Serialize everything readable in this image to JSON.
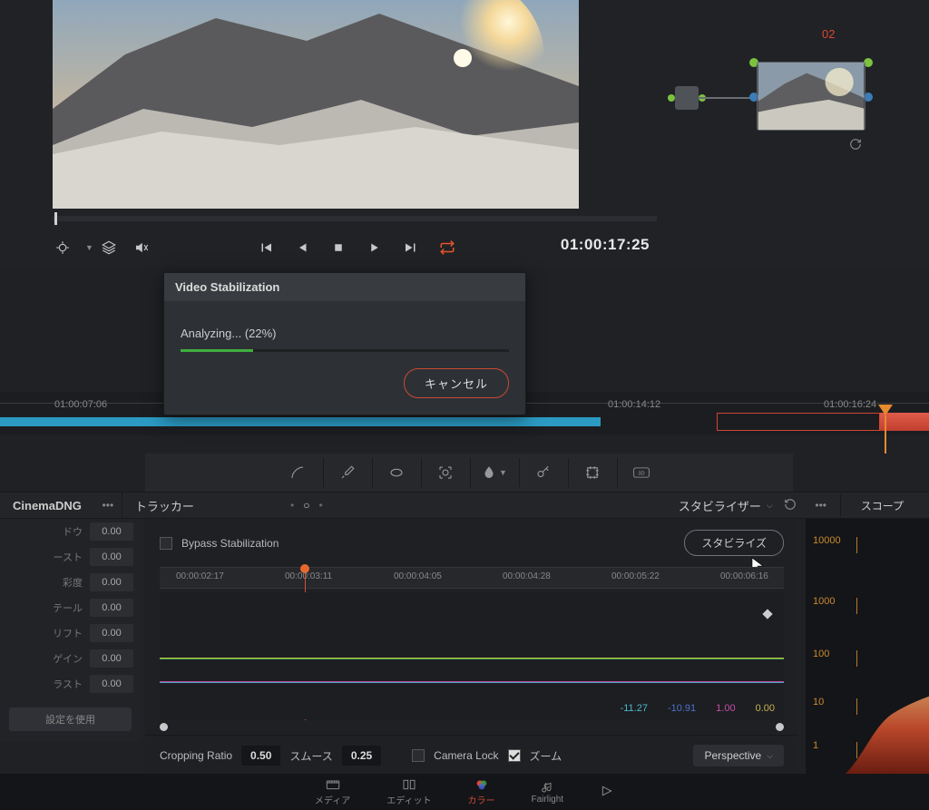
{
  "viewer": {
    "timecode": "01:00:17:25"
  },
  "node": {
    "label": "02"
  },
  "dialog": {
    "title": "Video Stabilization",
    "status": "Analyzing... (22%)",
    "progress_pct": 22,
    "cancel": "キャンセル"
  },
  "ruler": {
    "ticks": [
      {
        "label": "01:00:07:06",
        "pos": 60
      },
      {
        "label": "01:00:14:12",
        "pos": 670
      },
      {
        "label": "01:00:16:24",
        "pos": 908
      }
    ]
  },
  "panels": {
    "left_tab": "CinemaDNG",
    "tracker": "トラッカー",
    "stabilizer": "スタビライザー",
    "scope": "スコープ"
  },
  "params": [
    {
      "label": "ドウ",
      "value": "0.00"
    },
    {
      "label": "ースト",
      "value": "0.00"
    },
    {
      "label": "彩度",
      "value": "0.00"
    },
    {
      "label": "テール",
      "value": "0.00"
    },
    {
      "label": "リフト",
      "value": "0.00"
    },
    {
      "label": "ゲイン",
      "value": "0.00"
    },
    {
      "label": "ラスト",
      "value": "0.00"
    }
  ],
  "params_button": "設定を使用",
  "tracker_panel": {
    "bypass": "Bypass Stabilization",
    "stabilize": "スタビライズ",
    "ticks": [
      {
        "label": "00:00:02:17",
        "pos": 18
      },
      {
        "label": "00:00:03:11",
        "pos": 138
      },
      {
        "label": "00:00:04:05",
        "pos": 258
      },
      {
        "label": "00:00:04:28",
        "pos": 378
      },
      {
        "label": "00:00:05:22",
        "pos": 498
      },
      {
        "label": "00:00:06:16",
        "pos": 618
      }
    ],
    "graph_values": [
      {
        "v": "-11.27",
        "c": "#4fb8c9"
      },
      {
        "v": "-10.91",
        "c": "#4f72c9"
      },
      {
        "v": "1.00",
        "c": "#c94fa8"
      },
      {
        "v": "0.00",
        "c": "#c9b24f"
      }
    ],
    "cropping_label": "Cropping Ratio",
    "cropping_value": "0.50",
    "smooth_label": "スムース",
    "smooth_value": "0.25",
    "camera_lock": "Camera Lock",
    "zoom": "ズーム",
    "perspective": "Perspective"
  },
  "scope_scale": [
    "10000",
    "1000",
    "100",
    "10",
    "1"
  ],
  "nav": {
    "media": "メディア",
    "edit": "エディット",
    "color": "カラー",
    "fairlight": "Fairlight"
  }
}
